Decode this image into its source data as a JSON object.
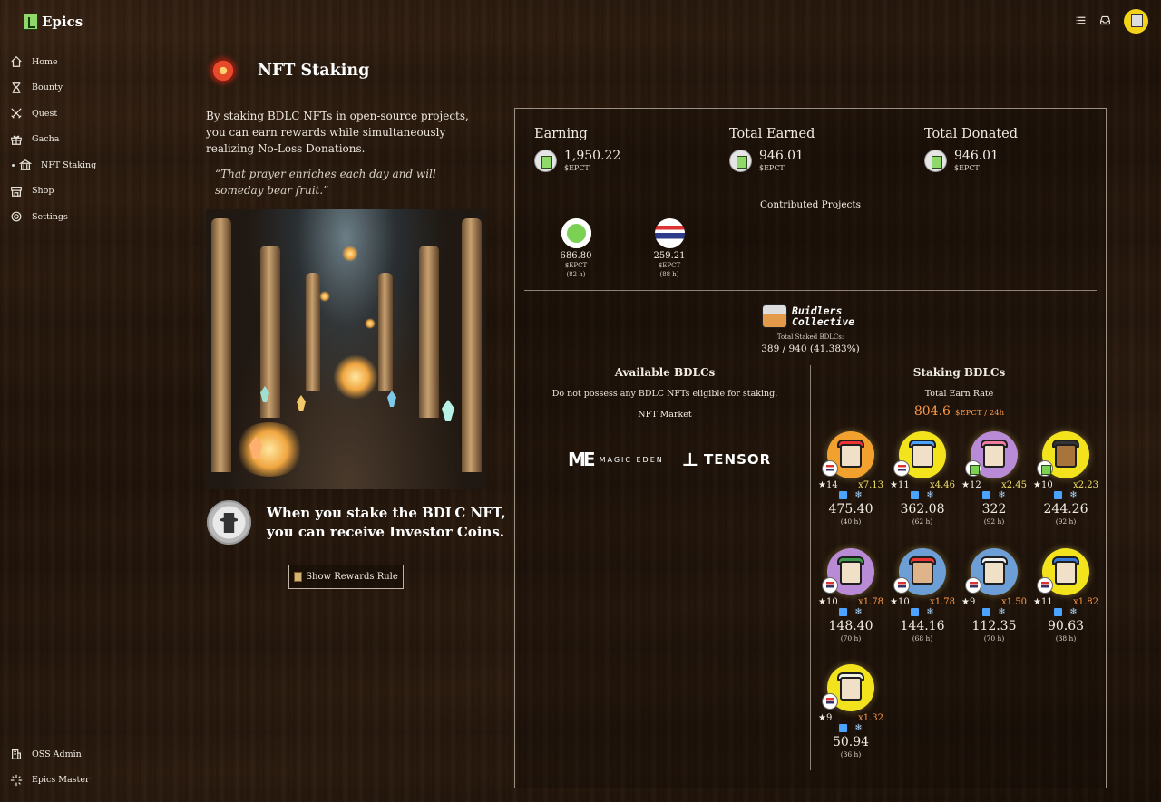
{
  "brand": {
    "name": "Epics"
  },
  "nav": {
    "items": [
      {
        "label": "Home",
        "icon": "home-icon"
      },
      {
        "label": "Bounty",
        "icon": "hourglass-icon"
      },
      {
        "label": "Quest",
        "icon": "swords-icon"
      },
      {
        "label": "Gacha",
        "icon": "gift-icon"
      },
      {
        "label": "NFT Staking",
        "icon": "bank-icon"
      },
      {
        "label": "Shop",
        "icon": "store-icon"
      },
      {
        "label": "Settings",
        "icon": "gear-icon"
      }
    ],
    "bottom": [
      {
        "label": "OSS Admin",
        "icon": "building-icon"
      },
      {
        "label": "Epics Master",
        "icon": "sparkle-icon"
      }
    ],
    "active": "NFT Staking"
  },
  "page": {
    "title": "NFT Staking",
    "intro": "By staking BDLC NFTs in open-source projects, you can earn rewards while simultaneously realizing No-Loss Donations.",
    "quote": "“That prayer enriches each day and will someday bear fruit.”",
    "investor_line1": "When you stake the BDLC NFT,",
    "investor_line2": "you can receive Investor Coins.",
    "rules_button": "Show Rewards Rule"
  },
  "stats": {
    "earning": {
      "label": "Earning",
      "value": "1,950.22",
      "unit": "$EPCT"
    },
    "total_earned": {
      "label": "Total Earned",
      "value": "946.01",
      "unit": "$EPCT"
    },
    "total_donated": {
      "label": "Total Donated",
      "value": "946.01",
      "unit": "$EPCT"
    }
  },
  "contributed": {
    "title": "Contributed Projects",
    "projects": [
      {
        "value": "686.80",
        "unit": "$EPCT",
        "hours": "(82 h)"
      },
      {
        "value": "259.21",
        "unit": "$EPCT",
        "hours": "(88 h)"
      }
    ]
  },
  "collection": {
    "name_line1": "Buidlers",
    "name_line2": "Collective",
    "staked_label": "Total Staked BDLCs:",
    "staked_value": "389 / 940 (41.383%)"
  },
  "available": {
    "title": "Available BDLCs",
    "message": "Do not possess any BDLC NFTs eligible for staking.",
    "market_label": "NFT Market",
    "magic_eden": {
      "mark": "ME",
      "text": "MAGIC EDEN"
    },
    "tensor": {
      "mark": "⊥",
      "text": "TENSOR"
    }
  },
  "staking": {
    "title": "Staking BDLCs",
    "rate_label": "Total Earn Rate",
    "rate_value": "804.6",
    "rate_unit": "$EPCT / 24h",
    "cards": [
      {
        "stars": "★14",
        "mult": "x7.13",
        "amount": "475.40",
        "hours": "(40 h)"
      },
      {
        "stars": "★11",
        "mult": "x4.46",
        "amount": "362.08",
        "hours": "(62 h)"
      },
      {
        "stars": "★12",
        "mult": "x2.45",
        "amount": "322",
        "hours": "(92 h)"
      },
      {
        "stars": "★10",
        "mult": "x2.23",
        "amount": "244.26",
        "hours": "(92 h)"
      },
      {
        "stars": "★10",
        "mult": "x1.78",
        "amount": "148.40",
        "hours": "(70 h)"
      },
      {
        "stars": "★10",
        "mult": "x1.78",
        "amount": "144.16",
        "hours": "(68 h)"
      },
      {
        "stars": "★9",
        "mult": "x1.50",
        "amount": "112.35",
        "hours": "(70 h)"
      },
      {
        "stars": "★11",
        "mult": "x1.82",
        "amount": "90.63",
        "hours": "(38 h)"
      },
      {
        "stars": "★9",
        "mult": "x1.32",
        "amount": "50.94",
        "hours": "(36 h)"
      }
    ]
  },
  "colors": {
    "accent_orange": "#ff9a48",
    "accent_yellow": "#f2e06a",
    "panel_border": "#9a8f82"
  }
}
